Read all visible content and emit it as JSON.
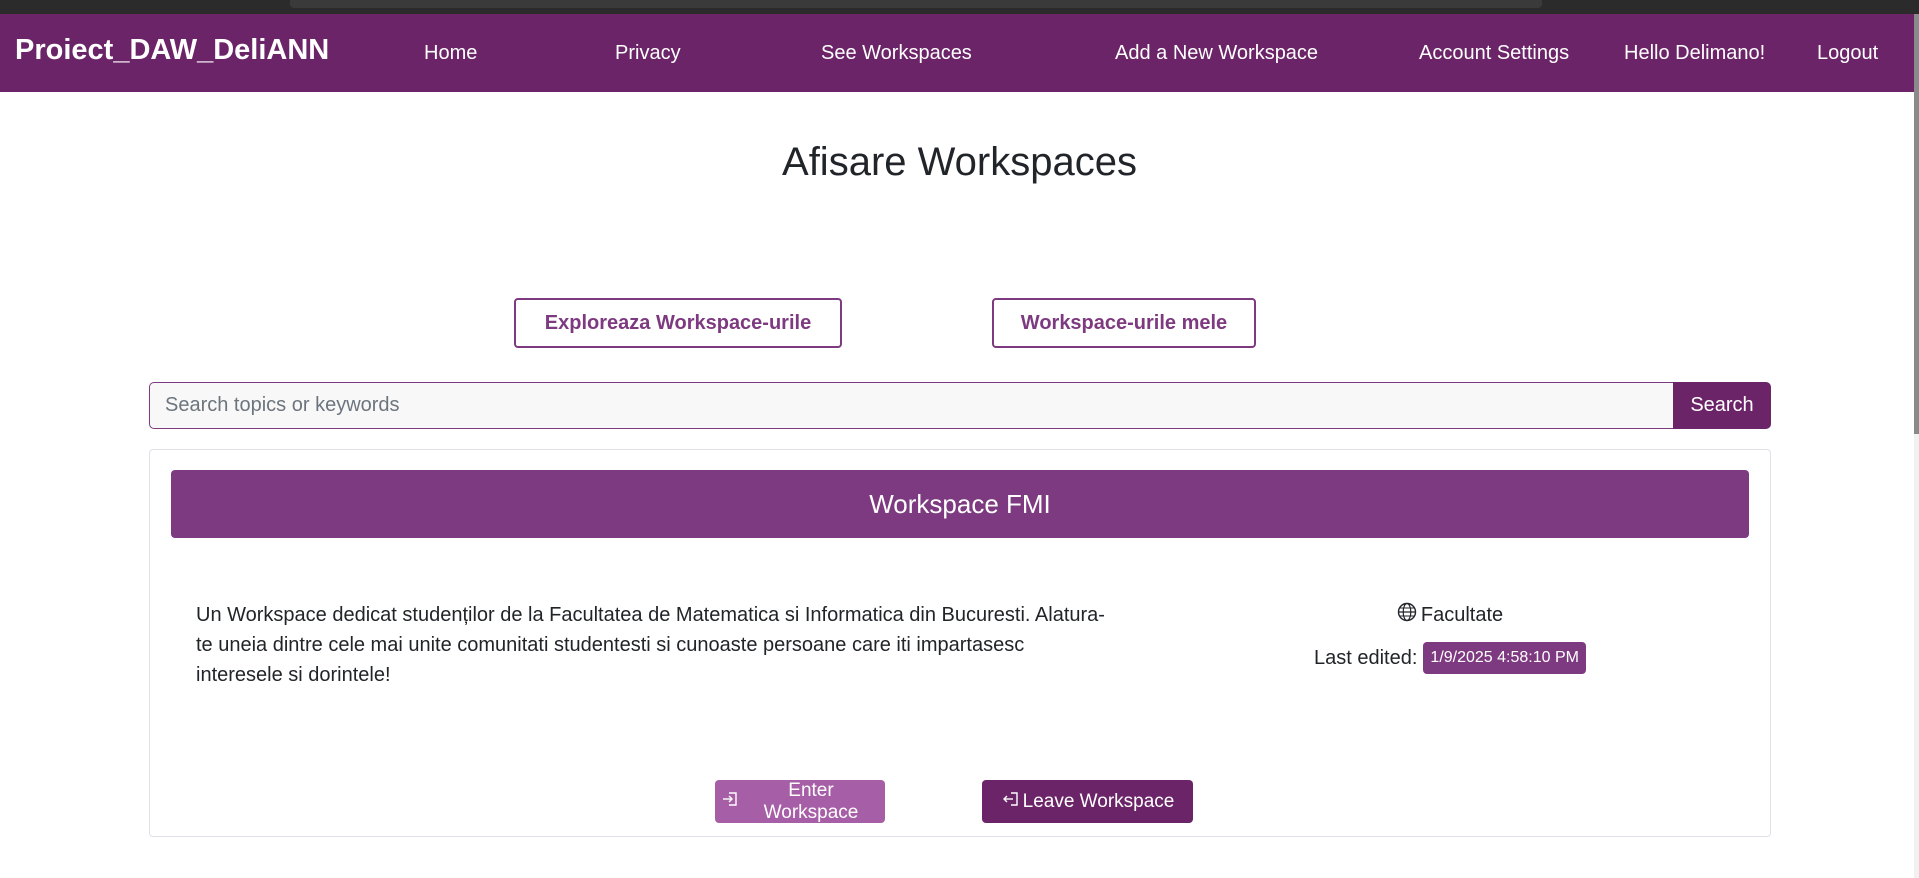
{
  "navbar": {
    "brand": "Proiect_DAW_DeliANN",
    "links": {
      "home": "Home",
      "privacy": "Privacy",
      "see_workspaces": "See Workspaces",
      "add_workspace": "Add a New Workspace",
      "account_settings": "Account Settings",
      "greeting": "Hello Delimano!",
      "logout": "Logout"
    }
  },
  "page": {
    "title": "Afisare Workspaces",
    "tabs": {
      "explore": "Exploreaza Workspace-urile",
      "mine": "Workspace-urile mele"
    }
  },
  "search": {
    "placeholder": "Search topics or keywords",
    "button": "Search"
  },
  "workspace": {
    "title": "Workspace FMI",
    "description": "Un Workspace dedicat studenților de la Facultatea de Matematica si Informatica din Bucuresti. Alatura-te uneia dintre cele mai unite comunitati studentesti si cunoaste persoane care iti impartasesc interesele si dorintele!",
    "category": "Facultate",
    "last_edited_label": "Last edited:",
    "last_edited_value": "1/9/2025 4:58:10 PM",
    "enter_label": "Enter Workspace",
    "leave_label": "Leave Workspace"
  },
  "colors": {
    "brand_purple": "#6b2468",
    "accent_purple": "#7e3a80",
    "light_purple": "#a65ea6"
  },
  "icons": {
    "category": "globe-icon",
    "enter": "enter-icon",
    "leave": "leave-icon"
  }
}
